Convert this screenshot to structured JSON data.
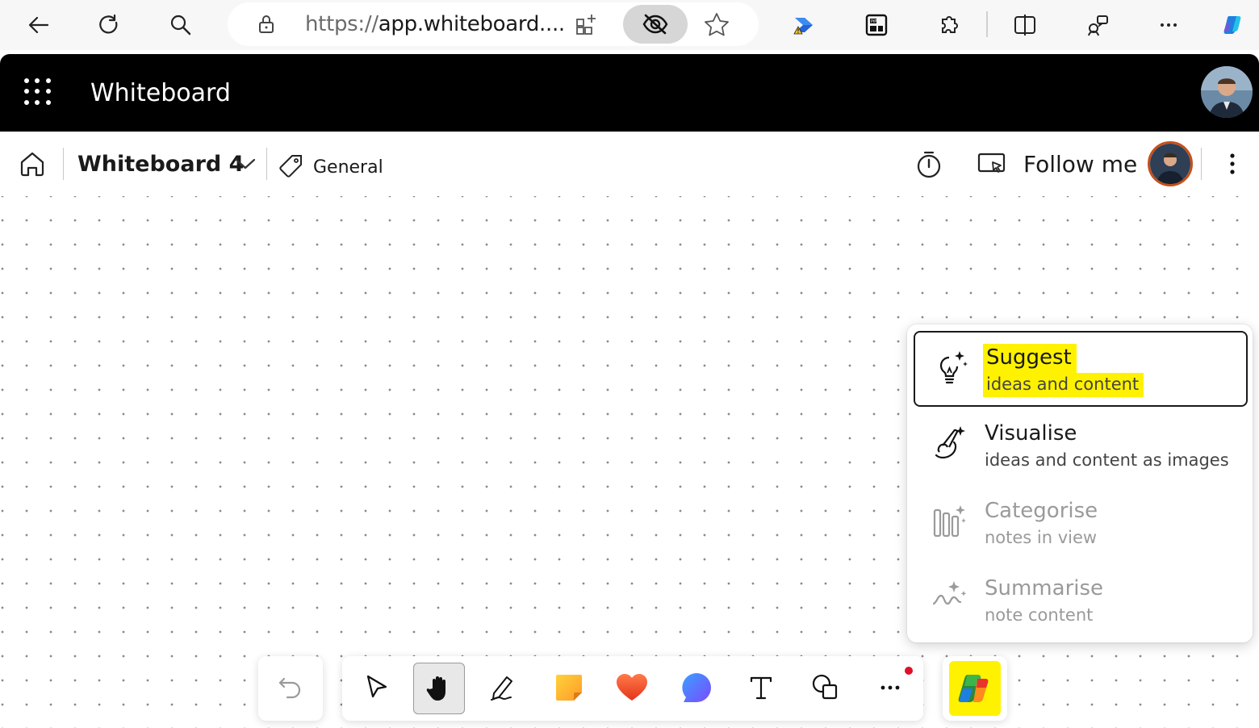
{
  "browser": {
    "url_protocol": "https://",
    "url_rest": "app.whiteboard....",
    "icons": [
      "back-icon",
      "refresh-icon",
      "search-icon",
      "lock-icon",
      "add-tab-icon",
      "hidden-eye-icon",
      "favorite-star-icon",
      "extension-warning-icon",
      "pip-icon",
      "extensions-icon",
      "split-screen-icon",
      "performance-icon",
      "more-icon",
      "copilot-icon"
    ]
  },
  "app": {
    "title": "Whiteboard"
  },
  "board": {
    "name": "Whiteboard 4",
    "tag": "General",
    "follow_label": "Follow me"
  },
  "copilot_menu": {
    "items": [
      {
        "title": "Suggest",
        "subtitle": "ideas and content",
        "icon": "lightbulb-sparkle-icon",
        "state": "selected"
      },
      {
        "title": "Visualise",
        "subtitle": "ideas and content as images",
        "icon": "paintbrush-sparkle-icon",
        "state": "enabled"
      },
      {
        "title": "Categorise",
        "subtitle": "notes in view",
        "icon": "columns-sparkle-icon",
        "state": "disabled"
      },
      {
        "title": "Summarise",
        "subtitle": "note content",
        "icon": "wave-sparkle-icon",
        "state": "disabled"
      }
    ]
  },
  "toolbar": {
    "tools": [
      "undo-icon",
      "select-arrow-icon",
      "hand-pan-icon",
      "pen-icon",
      "sticky-note-icon",
      "reactions-heart-icon",
      "comment-bubble-icon",
      "text-icon",
      "shapes-icon",
      "more-tools-icon",
      "copilot-icon"
    ],
    "active_tool": "hand-pan-icon"
  },
  "colors": {
    "highlight": "#fff200",
    "header_bg": "#000000",
    "avatar_ring": "#c4501b",
    "notification_dot": "#e0102a"
  }
}
